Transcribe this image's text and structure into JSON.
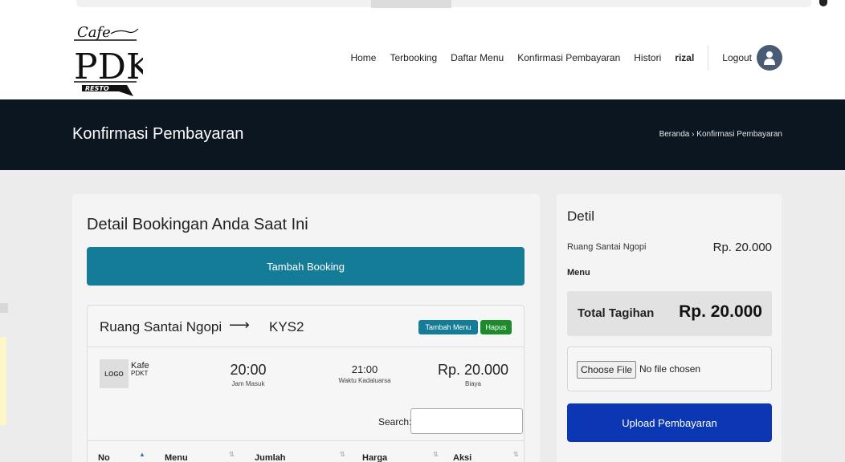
{
  "header": {
    "logo_text": "Cafe PDKT RESTO",
    "nav": [
      "Home",
      "Terbooking",
      "Daftar Menu",
      "Konfirmasi Pembayaran",
      "Histori"
    ],
    "user": "rizal",
    "logout": "Logout"
  },
  "banner": {
    "title": "Konfirmasi Pembayaran",
    "crumb_home": "Beranda",
    "crumb_sep": "›",
    "crumb_current": "Konfirmasi Pembayaran"
  },
  "booking": {
    "heading": "Detail Bookingan Anda Saat Ini",
    "add_button": "Tambah Booking",
    "room": "Ruang Santai Ngopi",
    "arrow": "⟶",
    "code": "KYS2",
    "tambah_menu": "Tambah Menu",
    "hapus": "Hapus",
    "logo_box": "LOGO",
    "kafe_top": "Kafe",
    "kafe_bottom": "PDKT",
    "jam_masuk_value": "20:00",
    "jam_masuk_label": "Jam Masuk",
    "kadaluarsa_value": "21:00",
    "kadaluarsa_label": "Waktu Kadaluarsa",
    "biaya_value": "Rp. 20.000",
    "biaya_label": "Biaya",
    "search_label": "Search:",
    "columns": [
      "No",
      "Menu",
      "Jumlah",
      "Harga",
      "Aksi"
    ]
  },
  "detail": {
    "heading": "Detil",
    "item_name": "Ruang Santai Ngopi",
    "item_price": "Rp. 20.000",
    "menu_label": "Menu",
    "total_label": "Total Tagihan",
    "total_amount": "Rp. 20.000",
    "choose_file": "Choose File",
    "no_file": "No file chosen",
    "upload_button": "Upload Pembayaran"
  },
  "colors": {
    "banner": "#0c1620",
    "primary_teal": "#147c96",
    "danger_green": "#1d8a2c",
    "upload_blue": "#0c37b4",
    "avatar": "#4a5b75"
  }
}
